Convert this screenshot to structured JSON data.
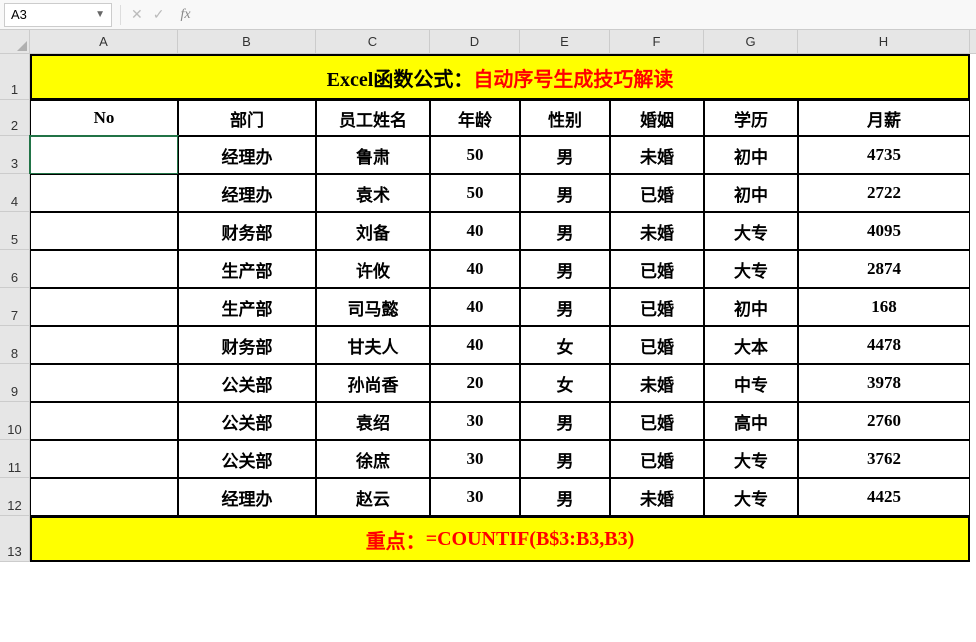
{
  "namebox": {
    "value": "A3"
  },
  "formula_bar": {
    "value": ""
  },
  "columns": [
    "A",
    "B",
    "C",
    "D",
    "E",
    "F",
    "G",
    "H"
  ],
  "title": {
    "black": "Excel函数公式：",
    "red": "自动序号生成技巧解读"
  },
  "headers": [
    "No",
    "部门",
    "员工姓名",
    "年龄",
    "性别",
    "婚姻",
    "学历",
    "月薪"
  ],
  "rows": [
    {
      "no": "",
      "dept": "经理办",
      "name": "鲁肃",
      "age": "50",
      "sex": "男",
      "marriage": "未婚",
      "edu": "初中",
      "salary": "4735"
    },
    {
      "no": "",
      "dept": "经理办",
      "name": "袁术",
      "age": "50",
      "sex": "男",
      "marriage": "已婚",
      "edu": "初中",
      "salary": "2722"
    },
    {
      "no": "",
      "dept": "财务部",
      "name": "刘备",
      "age": "40",
      "sex": "男",
      "marriage": "未婚",
      "edu": "大专",
      "salary": "4095"
    },
    {
      "no": "",
      "dept": "生产部",
      "name": "许攸",
      "age": "40",
      "sex": "男",
      "marriage": "已婚",
      "edu": "大专",
      "salary": "2874"
    },
    {
      "no": "",
      "dept": "生产部",
      "name": "司马懿",
      "age": "40",
      "sex": "男",
      "marriage": "已婚",
      "edu": "初中",
      "salary": "168"
    },
    {
      "no": "",
      "dept": "财务部",
      "name": "甘夫人",
      "age": "40",
      "sex": "女",
      "marriage": "已婚",
      "edu": "大本",
      "salary": "4478"
    },
    {
      "no": "",
      "dept": "公关部",
      "name": "孙尚香",
      "age": "20",
      "sex": "女",
      "marriage": "未婚",
      "edu": "中专",
      "salary": "3978"
    },
    {
      "no": "",
      "dept": "公关部",
      "name": "袁绍",
      "age": "30",
      "sex": "男",
      "marriage": "已婚",
      "edu": "高中",
      "salary": "2760"
    },
    {
      "no": "",
      "dept": "公关部",
      "name": "徐庶",
      "age": "30",
      "sex": "男",
      "marriage": "已婚",
      "edu": "大专",
      "salary": "3762"
    },
    {
      "no": "",
      "dept": "经理办",
      "name": "赵云",
      "age": "30",
      "sex": "男",
      "marriage": "未婚",
      "edu": "大专",
      "salary": "4425"
    }
  ],
  "bottom": {
    "label": "重点：",
    "formula": "=COUNTIF(B$3:B3,B3)"
  },
  "row_numbers": [
    "1",
    "2",
    "3",
    "4",
    "5",
    "6",
    "7",
    "8",
    "9",
    "10",
    "11",
    "12",
    "13"
  ],
  "active_cell": "A3"
}
